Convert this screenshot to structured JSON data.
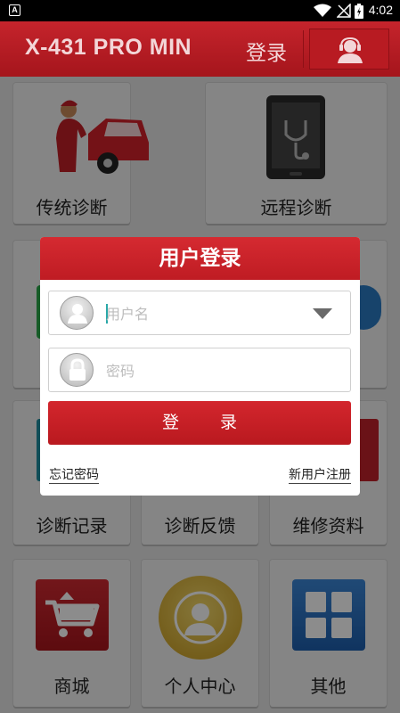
{
  "status_bar": {
    "time": "4:02",
    "app_icon_letter": "A",
    "icons": [
      "wifi-icon",
      "signal-icon",
      "battery-icon"
    ]
  },
  "header": {
    "title": "X-431 PRO MIN",
    "login_label": "登录",
    "user_icon": "user-headset-icon"
  },
  "tiles": [
    {
      "label": "传统诊断",
      "icon": "mechanic-car-icon"
    },
    {
      "label": "远程诊断",
      "icon": "tablet-stethoscope-icon"
    },
    {
      "label": "",
      "icon": "obscured"
    },
    {
      "label": "",
      "icon": "obscured"
    },
    {
      "label": "诊断记录",
      "icon": "record-icon"
    },
    {
      "label": "诊断反馈",
      "icon": "feedback-icon"
    },
    {
      "label": "维修资料",
      "icon": "repair-doc-icon"
    },
    {
      "label": "商城",
      "icon": "shopping-cart-icon"
    },
    {
      "label": "个人中心",
      "icon": "person-center-icon"
    },
    {
      "label": "其他",
      "icon": "grid-other-icon"
    }
  ],
  "login_dialog": {
    "title": "用户登录",
    "username_placeholder": "用户名",
    "password_placeholder": "密码",
    "submit_label": "登 录",
    "forgot_password": "忘记密码",
    "register": "新用户注册"
  },
  "colors": {
    "brand_red": "#c5242c",
    "dialog_button": "#c71f26",
    "tile_bg": "#f3f3f3"
  }
}
